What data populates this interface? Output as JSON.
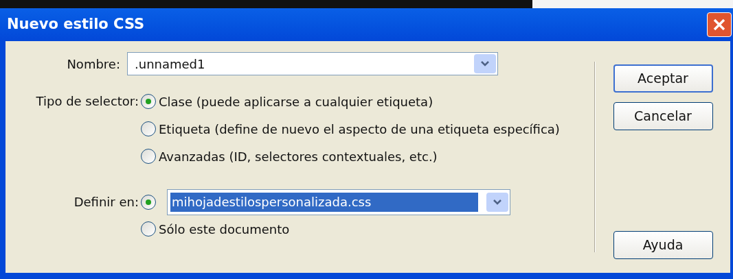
{
  "window": {
    "title": "Nuevo estilo CSS"
  },
  "name_field": {
    "label": "Nombre:",
    "value": ".unnamed1"
  },
  "selector_type": {
    "label": "Tipo de selector:",
    "options": [
      {
        "label": "Clase (puede aplicarse a cualquier etiqueta)",
        "selected": true
      },
      {
        "label": "Etiqueta (define de nuevo el aspecto de una etiqueta específica)",
        "selected": false
      },
      {
        "label": "Avanzadas (ID, selectores contextuales, etc.)",
        "selected": false
      }
    ]
  },
  "define_in": {
    "label": "Definir en:",
    "options": [
      {
        "kind": "dropdown",
        "value": "mihojadestilospersonalizada.css",
        "text_selected": true,
        "selected": true
      },
      {
        "kind": "text",
        "label": "Sólo este documento",
        "selected": false
      }
    ]
  },
  "buttons": [
    {
      "label": "Aceptar",
      "default": true,
      "kind": "action"
    },
    {
      "label": "Cancelar",
      "default": false,
      "kind": "action"
    },
    {
      "label": "Ayuda",
      "default": false,
      "kind": "help"
    }
  ]
}
